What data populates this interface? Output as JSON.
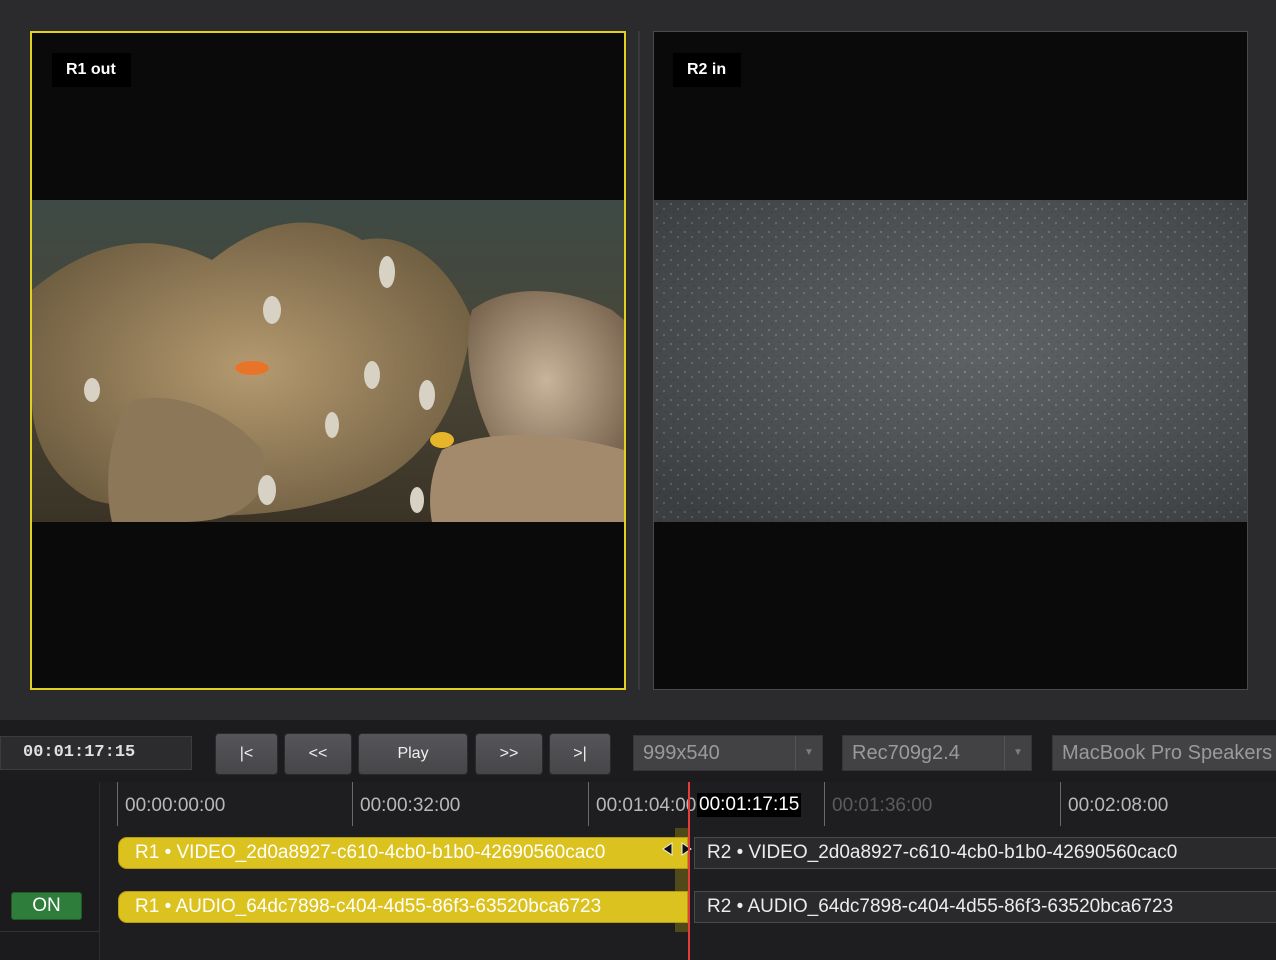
{
  "viewers": {
    "left": {
      "label": "R1 out",
      "active": true,
      "border_color": "#e2cf25"
    },
    "right": {
      "label": "R2 in",
      "active": false
    }
  },
  "controls": {
    "timecode": "00:01:17:15",
    "buttons": {
      "go_start": "|<",
      "rewind": "<<",
      "play": "Play",
      "fast_forward": ">>",
      "go_end": ">|"
    },
    "resolution": "999x540",
    "color_space": "Rec709g2.4",
    "audio_output": "MacBook Pro Speakers"
  },
  "timeline": {
    "ruler_ticks": [
      "00:00:00:00",
      "00:00:32:00",
      "00:01:04:00",
      "00:01:36:00",
      "00:02:08:00"
    ],
    "playhead_time": "00:01:17:15",
    "on_label": "ON",
    "clips": {
      "r1_video": "R1 • VIDEO_2d0a8927-c610-4cb0-b1b0-42690560cac0",
      "r2_video": "R2 • VIDEO_2d0a8927-c610-4cb0-b1b0-42690560cac0",
      "r1_audio": "R1 • AUDIO_64dc7898-c404-4d55-86f3-63520bca6723",
      "r2_audio": "R2 • AUDIO_64dc7898-c404-4d55-86f3-63520bca6723"
    },
    "colors": {
      "r1_clip": "#dcc21f",
      "playhead": "#e83b3b",
      "on_button": "#2e7d3a"
    }
  }
}
